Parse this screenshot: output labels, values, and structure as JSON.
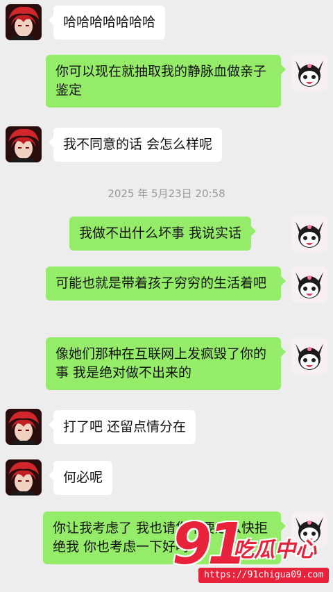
{
  "messages": [
    {
      "side": "in",
      "text": "哈哈哈哈哈哈哈",
      "avatar": "red-hair-avatar"
    },
    {
      "side": "out",
      "text": "你可以现在就抽取我的静脉血做亲子鉴定",
      "avatar": "kuromi-avatar"
    },
    {
      "side": "in",
      "text": "我不同意的话 会怎么样呢",
      "avatar": "red-hair-avatar"
    },
    {
      "side": "out",
      "text": "我做不出什么坏事 我说实话",
      "avatar": "kuromi-avatar"
    },
    {
      "side": "out",
      "text": "可能也就是带着孩子穷穷的生活着吧",
      "avatar": "kuromi-avatar"
    },
    {
      "side": "out",
      "text": "像她们那种在互联网上发疯毁了你的事 我是绝对做不出来的",
      "avatar": "kuromi-avatar"
    },
    {
      "side": "in",
      "text": "打了吧 还留点情分在",
      "avatar": "red-hair-avatar"
    },
    {
      "side": "in",
      "text": "何必呢",
      "avatar": "red-hair-avatar"
    },
    {
      "side": "out",
      "text": "你让我考虑了 我也请您不要这么快拒绝我 你也考虑一下好吗",
      "avatar": "kuromi-avatar"
    }
  ],
  "timestamp": "2025 年 5月23日 20:58",
  "watermark": {
    "number": "91",
    "name": "吃瓜中心",
    "url": "https://91chigua09.com"
  },
  "colors": {
    "background": "#ededed",
    "bubble_in": "#ffffff",
    "bubble_out": "#95ec69",
    "watermark": "#e8223a"
  }
}
